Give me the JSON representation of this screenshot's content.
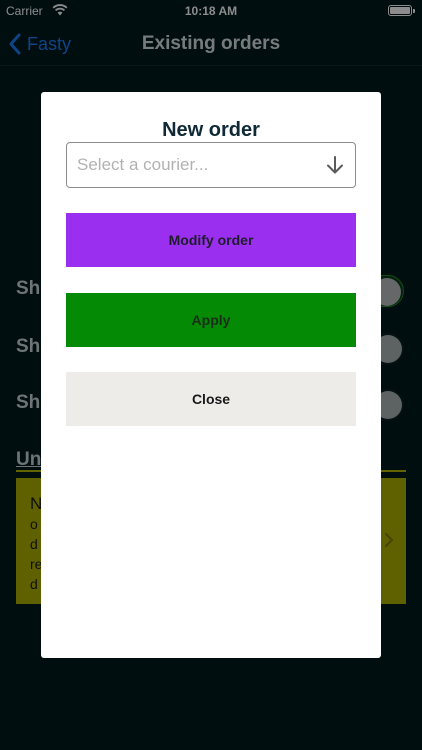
{
  "status_bar": {
    "carrier": "Carrier",
    "time": "10:18 AM"
  },
  "nav": {
    "back_label": "Fasty",
    "title": "Existing orders"
  },
  "background": {
    "rows": [
      "Sh",
      "Sh",
      "Sh"
    ],
    "section_heading": "Un",
    "card_lines": [
      "N",
      "o",
      "d",
      "re",
      "d"
    ]
  },
  "modal": {
    "title": "New order",
    "courier_placeholder": "Select a courier...",
    "modify_label": "Modify order",
    "apply_label": "Apply",
    "close_label": "Close"
  },
  "colors": {
    "background": "#021a1e",
    "accent_link": "#1a7cf5",
    "modify": "#9b2ff0",
    "apply": "#048a04",
    "close": "#edece8",
    "card": "#aeb000"
  }
}
